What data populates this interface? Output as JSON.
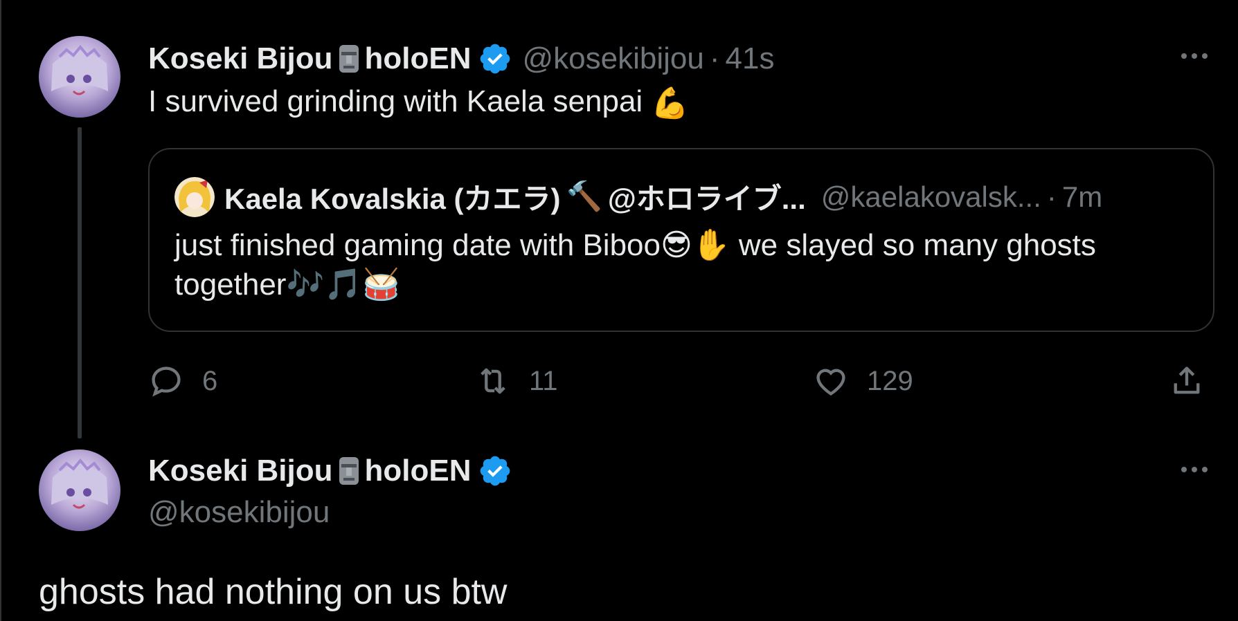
{
  "colors": {
    "background": "#000000",
    "text": "#e7e9ea",
    "muted": "#71767b",
    "verified_blue": "#1d9bf0",
    "border": "#2f3336"
  },
  "tweet1": {
    "author": "Koseki Bijou",
    "author_suffix": "holoEN",
    "handle": "@kosekibijou",
    "time": "41s",
    "text": "I survived grinding with Kaela senpai",
    "emoji": "💪",
    "quote": {
      "author": "Kaela Kovalskia (カエラ)",
      "author_emoji": "🔨",
      "author_suffix": "@ホロライブ...",
      "handle": "@kaelakovalsk...",
      "time": "7m",
      "text_line1": "just finished gaming date with Biboo😎✋ we slayed so many ghosts",
      "text_line2": "together🎶🎵🥁"
    },
    "actions": {
      "replies": "6",
      "retweets": "11",
      "likes": "129"
    }
  },
  "tweet2": {
    "author": "Koseki Bijou",
    "author_suffix": "holoEN",
    "handle": "@kosekibijou",
    "text": "ghosts had nothing on us btw"
  },
  "icons": {
    "moai": "moai-icon",
    "verified": "verified-badge-icon",
    "more": "more-options-icon",
    "reply": "reply-icon",
    "retweet": "retweet-icon",
    "like": "heart-icon",
    "share": "share-icon"
  }
}
